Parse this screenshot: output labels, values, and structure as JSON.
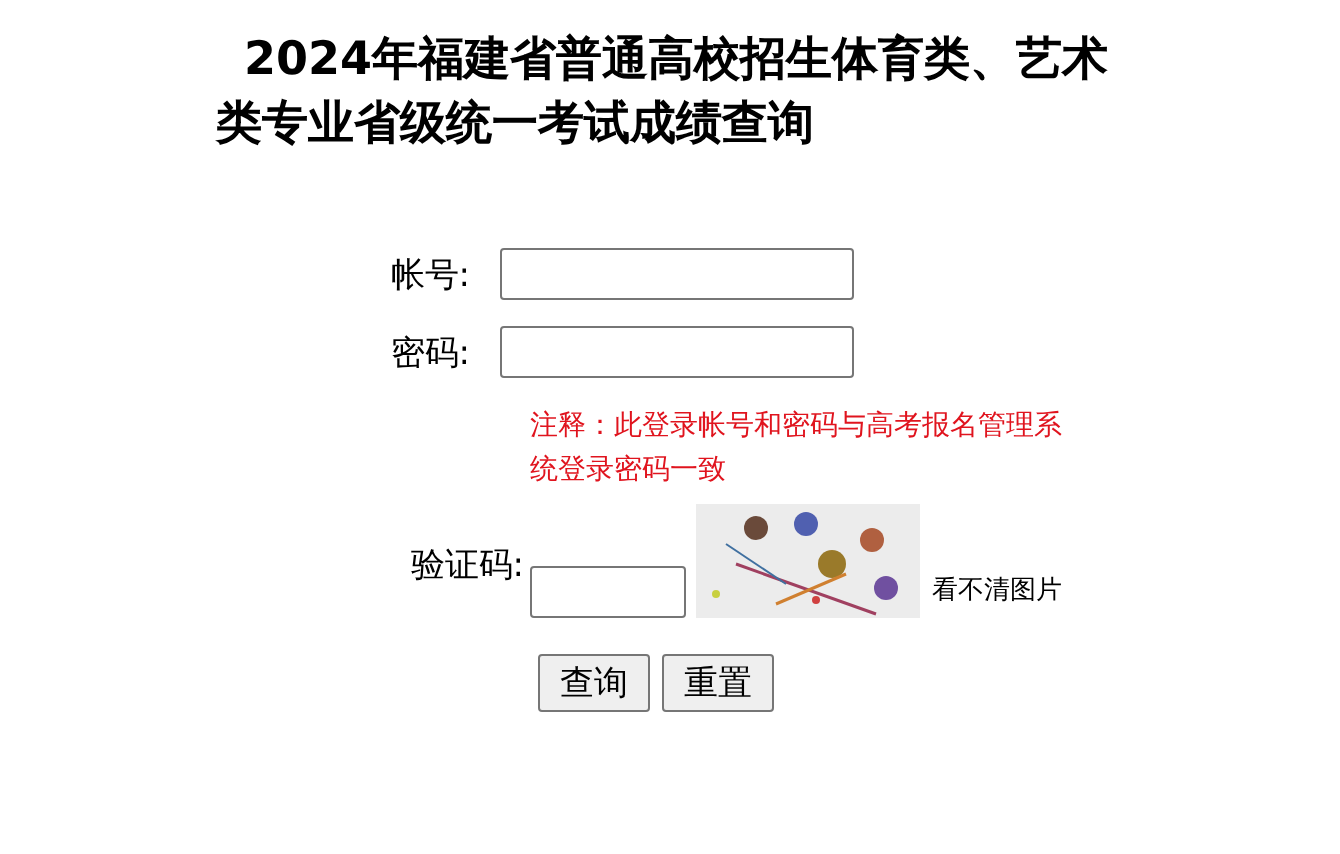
{
  "title": "2024年福建省普通高校招生体育类、艺术类专业省级统一考试成绩查询",
  "fields": [
    {
      "label": "帐号:"
    },
    {
      "label": "密码:"
    }
  ],
  "note": "注释：此登录帐号和密码与高考报名管理系统登录密码一致",
  "captcha": {
    "label": "验证码:",
    "refresh_link": "看不清图片"
  },
  "buttons": [
    "查询",
    "重置"
  ]
}
